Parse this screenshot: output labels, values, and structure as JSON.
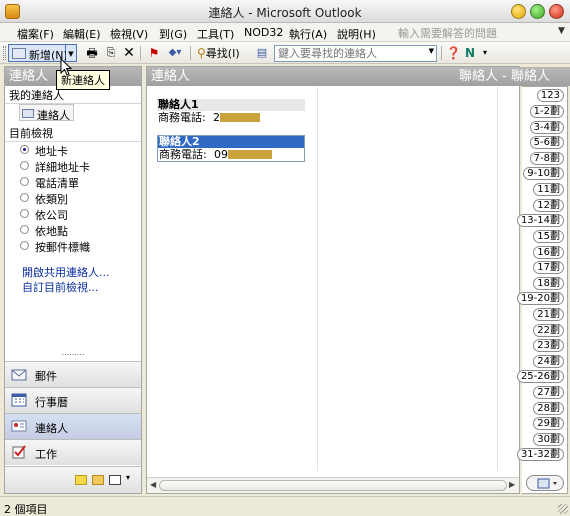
{
  "window": {
    "title": "連絡人 - Microsoft Outlook"
  },
  "menu": {
    "items": [
      "檔案(F)",
      "編輯(E)",
      "檢視(V)",
      "到(G)",
      "工具(T)",
      "NOD32",
      "執行(A)",
      "說明(H)"
    ],
    "help_placeholder": "輸入需要解答的問題"
  },
  "toolbar": {
    "new_label": "新增(N)",
    "find_label": "尋找(I)",
    "contact_search_placeholder": "鍵入要尋找的連絡人",
    "new_tooltip": "新連絡人"
  },
  "nav": {
    "header": "連絡人",
    "my_contacts_heading": "我的連絡人",
    "my_contacts_item": "連絡人",
    "current_view_heading": "目前檢視",
    "views": [
      {
        "label": "地址卡",
        "selected": true
      },
      {
        "label": "詳細地址卡",
        "selected": false
      },
      {
        "label": "電話清單",
        "selected": false
      },
      {
        "label": "依類別",
        "selected": false
      },
      {
        "label": "依公司",
        "selected": false
      },
      {
        "label": "依地點",
        "selected": false
      },
      {
        "label": "按郵件標幟",
        "selected": false
      }
    ],
    "links": [
      "開啟共用連絡人...",
      "自訂目前檢視..."
    ],
    "buttons": [
      "郵件",
      "行事曆",
      "連絡人",
      "工作"
    ],
    "active_button": "連絡人"
  },
  "main": {
    "header": "連絡人",
    "range": "聯絡人 - 聯絡人",
    "cards": [
      {
        "name": "聯絡人1",
        "field_label": "商務電話:",
        "value": "2",
        "selected": false
      },
      {
        "name": "聯絡人2",
        "field_label": "商務電話:",
        "value": "09",
        "selected": true
      }
    ]
  },
  "index": [
    "123",
    "1-2劃",
    "3-4劃",
    "5-6劃",
    "7-8劃",
    "9-10劃",
    "11劃",
    "12劃",
    "13-14劃",
    "15劃",
    "16劃",
    "17劃",
    "18劃",
    "19-20劃",
    "21劃",
    "22劃",
    "23劃",
    "24劃",
    "25-26劃",
    "27劃",
    "28劃",
    "29劃",
    "30劃",
    "31-32劃"
  ],
  "status": {
    "text": "2 個項目"
  },
  "colors": {
    "selection": "#316ac5",
    "header_gray": "#a0a0a0",
    "link": "#0a2d9b",
    "redaction": "#c9a33c"
  }
}
